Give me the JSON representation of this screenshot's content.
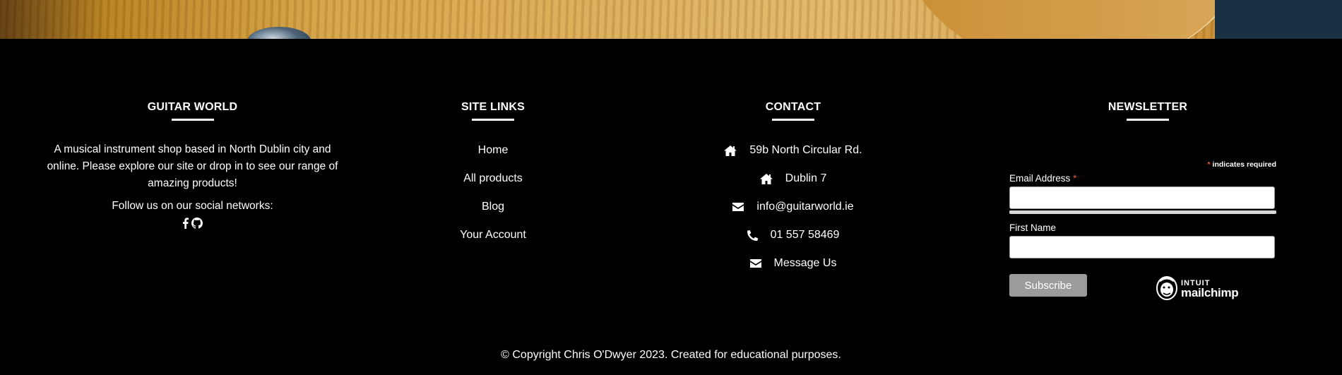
{
  "about": {
    "title": "GUITAR WORLD",
    "description": "A musical instrument shop based in North Dublin city and online. Please explore our site or drop in to see our range of amazing products!",
    "follow_text": "Follow us on our social networks:",
    "social_icons": [
      "facebook-icon",
      "github-icon"
    ]
  },
  "site_links": {
    "title": "SITE LINKS",
    "items": [
      {
        "label": "Home"
      },
      {
        "label": "All products"
      },
      {
        "label": "Blog"
      },
      {
        "label": "Your Account"
      }
    ]
  },
  "contact": {
    "title": "CONTACT",
    "rows": [
      {
        "icon": "home-icon",
        "text": "59b North Circular Rd."
      },
      {
        "icon": "home-icon",
        "text": "Dublin 7"
      },
      {
        "icon": "envelope-icon",
        "text": "info@guitarworld.ie"
      },
      {
        "icon": "phone-icon",
        "text": "01 557 58469"
      },
      {
        "icon": "envelope-icon",
        "text": "Message Us"
      }
    ]
  },
  "newsletter": {
    "title": "NEWSLETTER",
    "required_star": "*",
    "required_note": " indicates required",
    "email_label": "Email Address",
    "email_value": "",
    "first_name_label": "First Name",
    "first_name_value": "",
    "subscribe_label": "Subscribe",
    "brand_top": "INTUIT",
    "brand_bottom": "mailchimp"
  },
  "footer": {
    "copyright": "© Copyright Chris O'Dwyer 2023. Created for educational purposes."
  },
  "colors": {
    "background": "#000000",
    "text": "#ffffff",
    "required": "#e85c41",
    "button": "#9b9b9b"
  }
}
